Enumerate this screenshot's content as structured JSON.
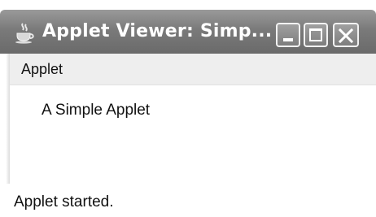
{
  "window": {
    "title": "Applet Viewer: Simp...",
    "icons": {
      "app": "java-cup-icon",
      "minimize": "minimize-icon",
      "maximize": "maximize-icon",
      "close": "close-icon"
    }
  },
  "menubar": {
    "items": [
      {
        "label": "Applet"
      }
    ]
  },
  "content": {
    "text": "A Simple Applet"
  },
  "status": {
    "text": "Applet started."
  }
}
